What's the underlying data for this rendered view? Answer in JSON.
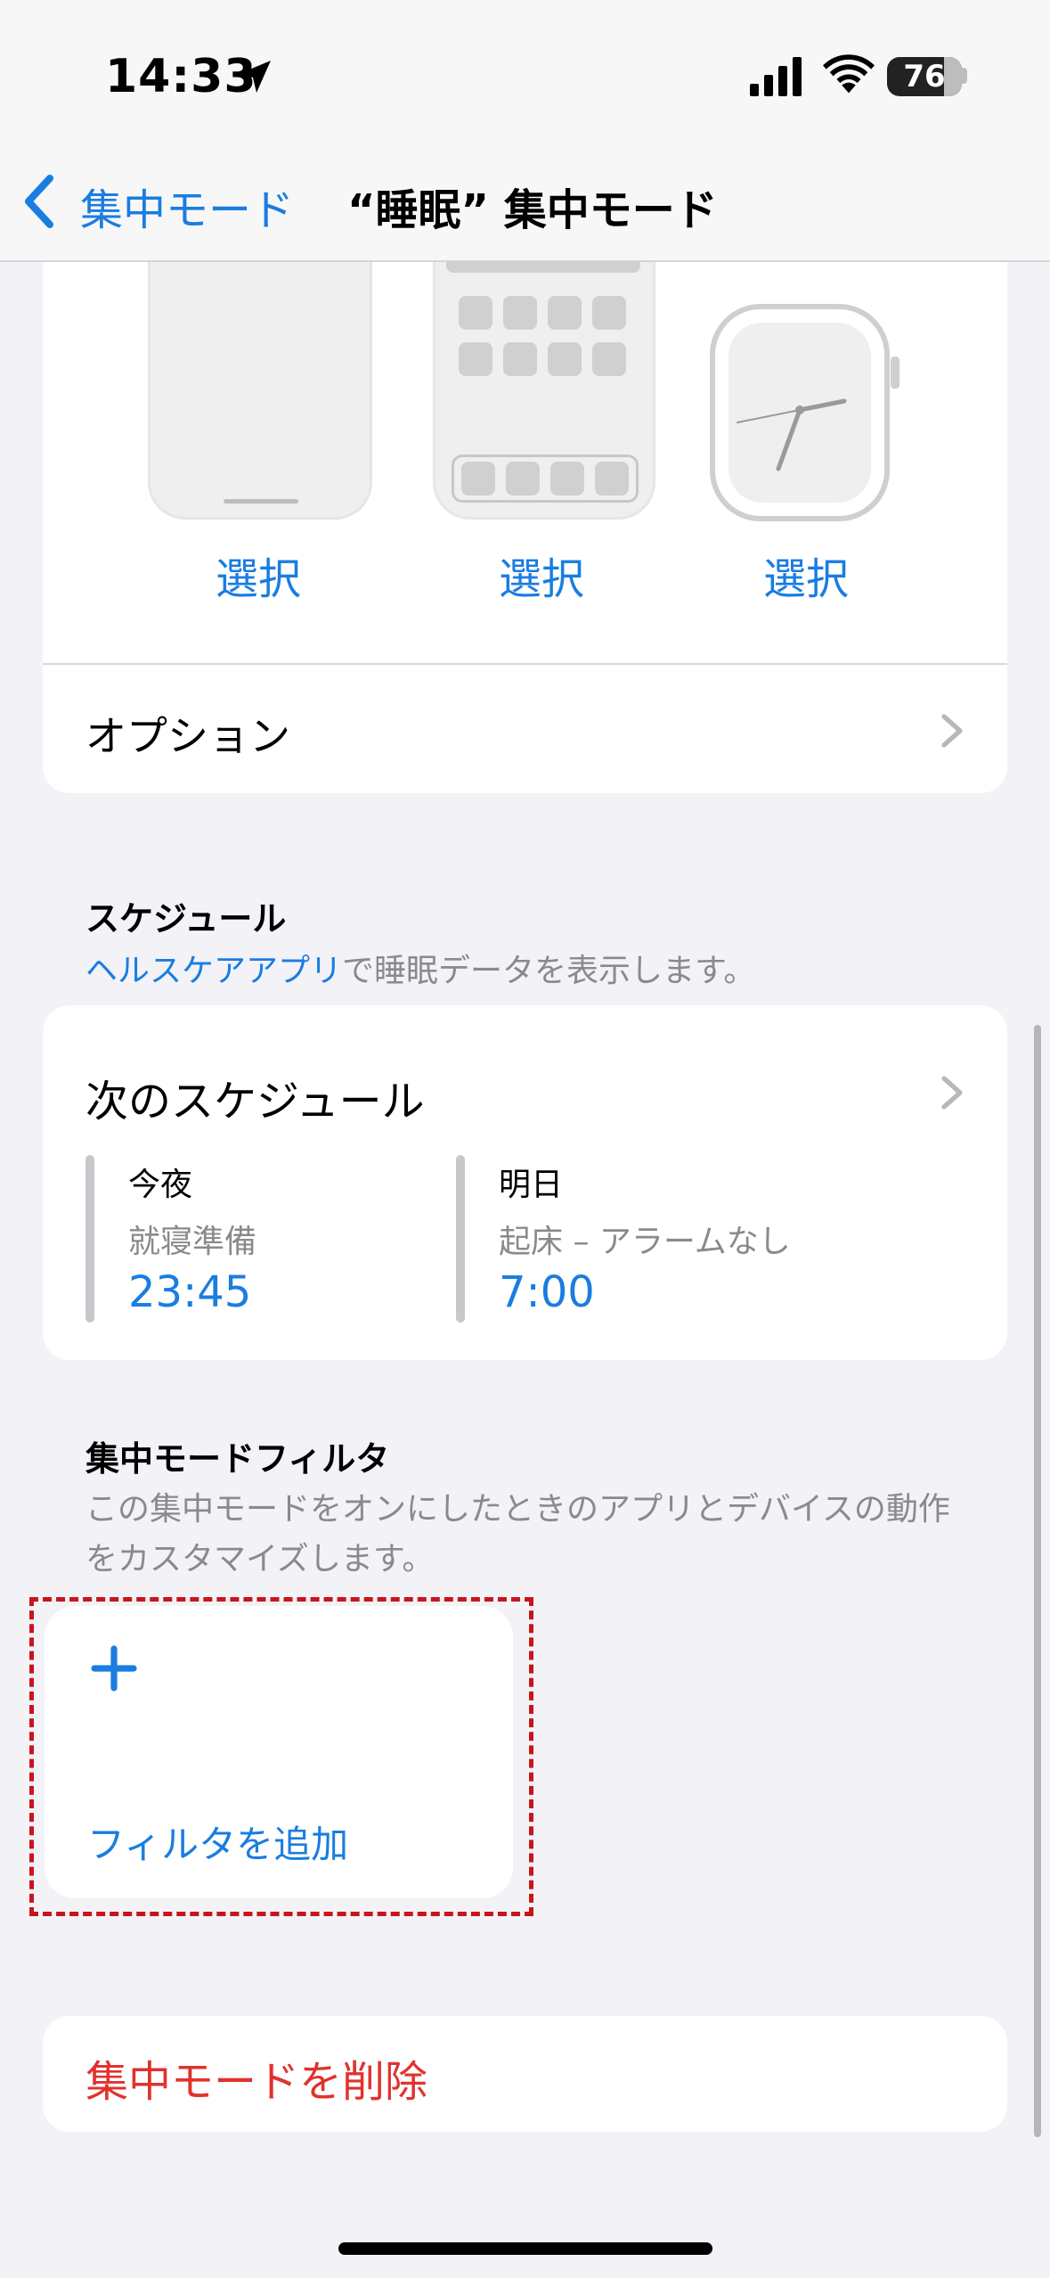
{
  "status_bar": {
    "time": "14:33",
    "battery_level": "76",
    "battery_fraction": 0.76
  },
  "nav": {
    "back_label": "集中モード",
    "title": "“睡眠” 集中モード"
  },
  "customize": {
    "select_labels": [
      "選択",
      "選択",
      "選択"
    ],
    "options_label": "オプション"
  },
  "schedule": {
    "header": "スケジュール",
    "desc_link": "ヘルスケアアプリ",
    "desc_rest": "で睡眠データを表示します。",
    "next_title": "次のスケジュール",
    "items": [
      {
        "day": "今夜",
        "kind": "就寝準備",
        "time": "23:45"
      },
      {
        "day": "明日",
        "kind": "起床 – アラームなし",
        "time": "7:00"
      }
    ]
  },
  "filters": {
    "header": "集中モードフィルタ",
    "desc": "この集中モードをオンにしたときのアプリとデバイスの動作をカスタマイズします。",
    "add_label": "フィルタを追加"
  },
  "delete_label": "集中モードを削除",
  "colors": {
    "accent": "#1a7de0",
    "destructive": "#e0322d",
    "highlight_outline": "#c8151a",
    "background": "#f2f2f7"
  }
}
